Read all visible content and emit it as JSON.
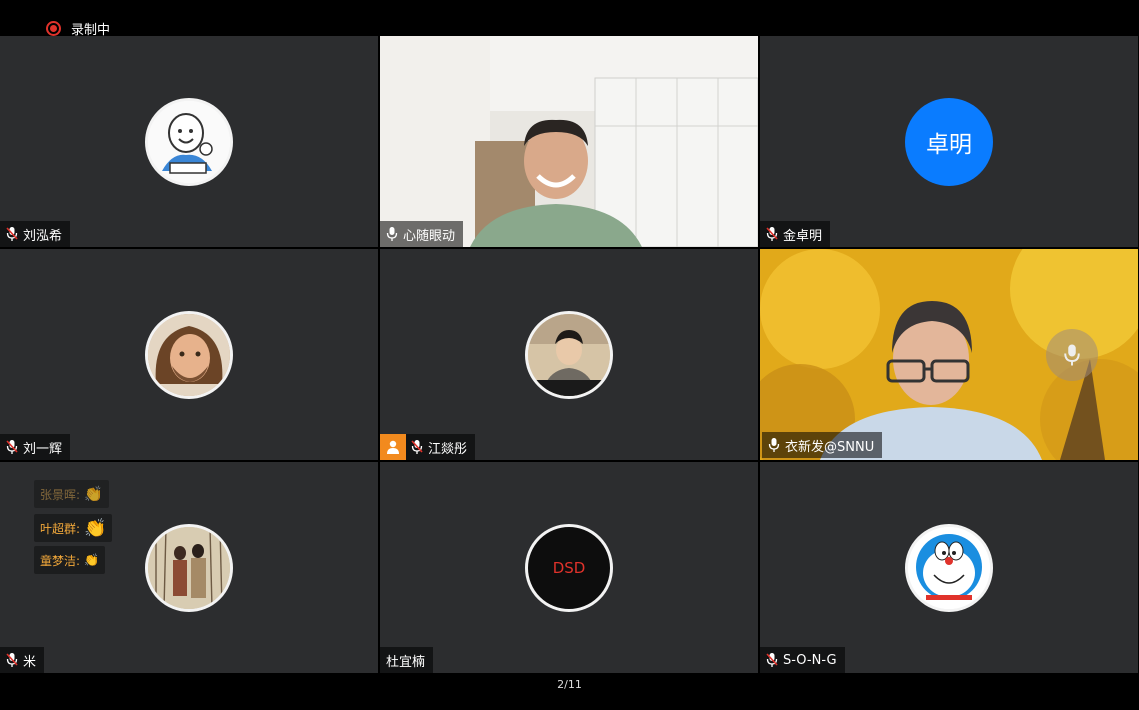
{
  "recording": {
    "label": "录制中"
  },
  "pager": {
    "label": "2/11"
  },
  "participants": [
    {
      "name": "刘泓希"
    },
    {
      "name": "心随眼动"
    },
    {
      "name": "金卓明",
      "avatar_text": "卓明"
    },
    {
      "name": "刘一辉"
    },
    {
      "name": "江燚彤"
    },
    {
      "name": "衣新发@SNNU"
    },
    {
      "name": "米"
    },
    {
      "name": "杜宜楠",
      "avatar_text": "DSD"
    },
    {
      "name": "S-O-N-G"
    }
  ],
  "reactions": [
    {
      "text": "张景晖:"
    },
    {
      "text": "叶超群:"
    },
    {
      "text": "童梦洁:"
    }
  ],
  "colors": {
    "speaking": "#35c25a",
    "avatar_blue": "#0a7cff",
    "record_red": "#e0322b",
    "host_orange": "#f28a1e"
  }
}
